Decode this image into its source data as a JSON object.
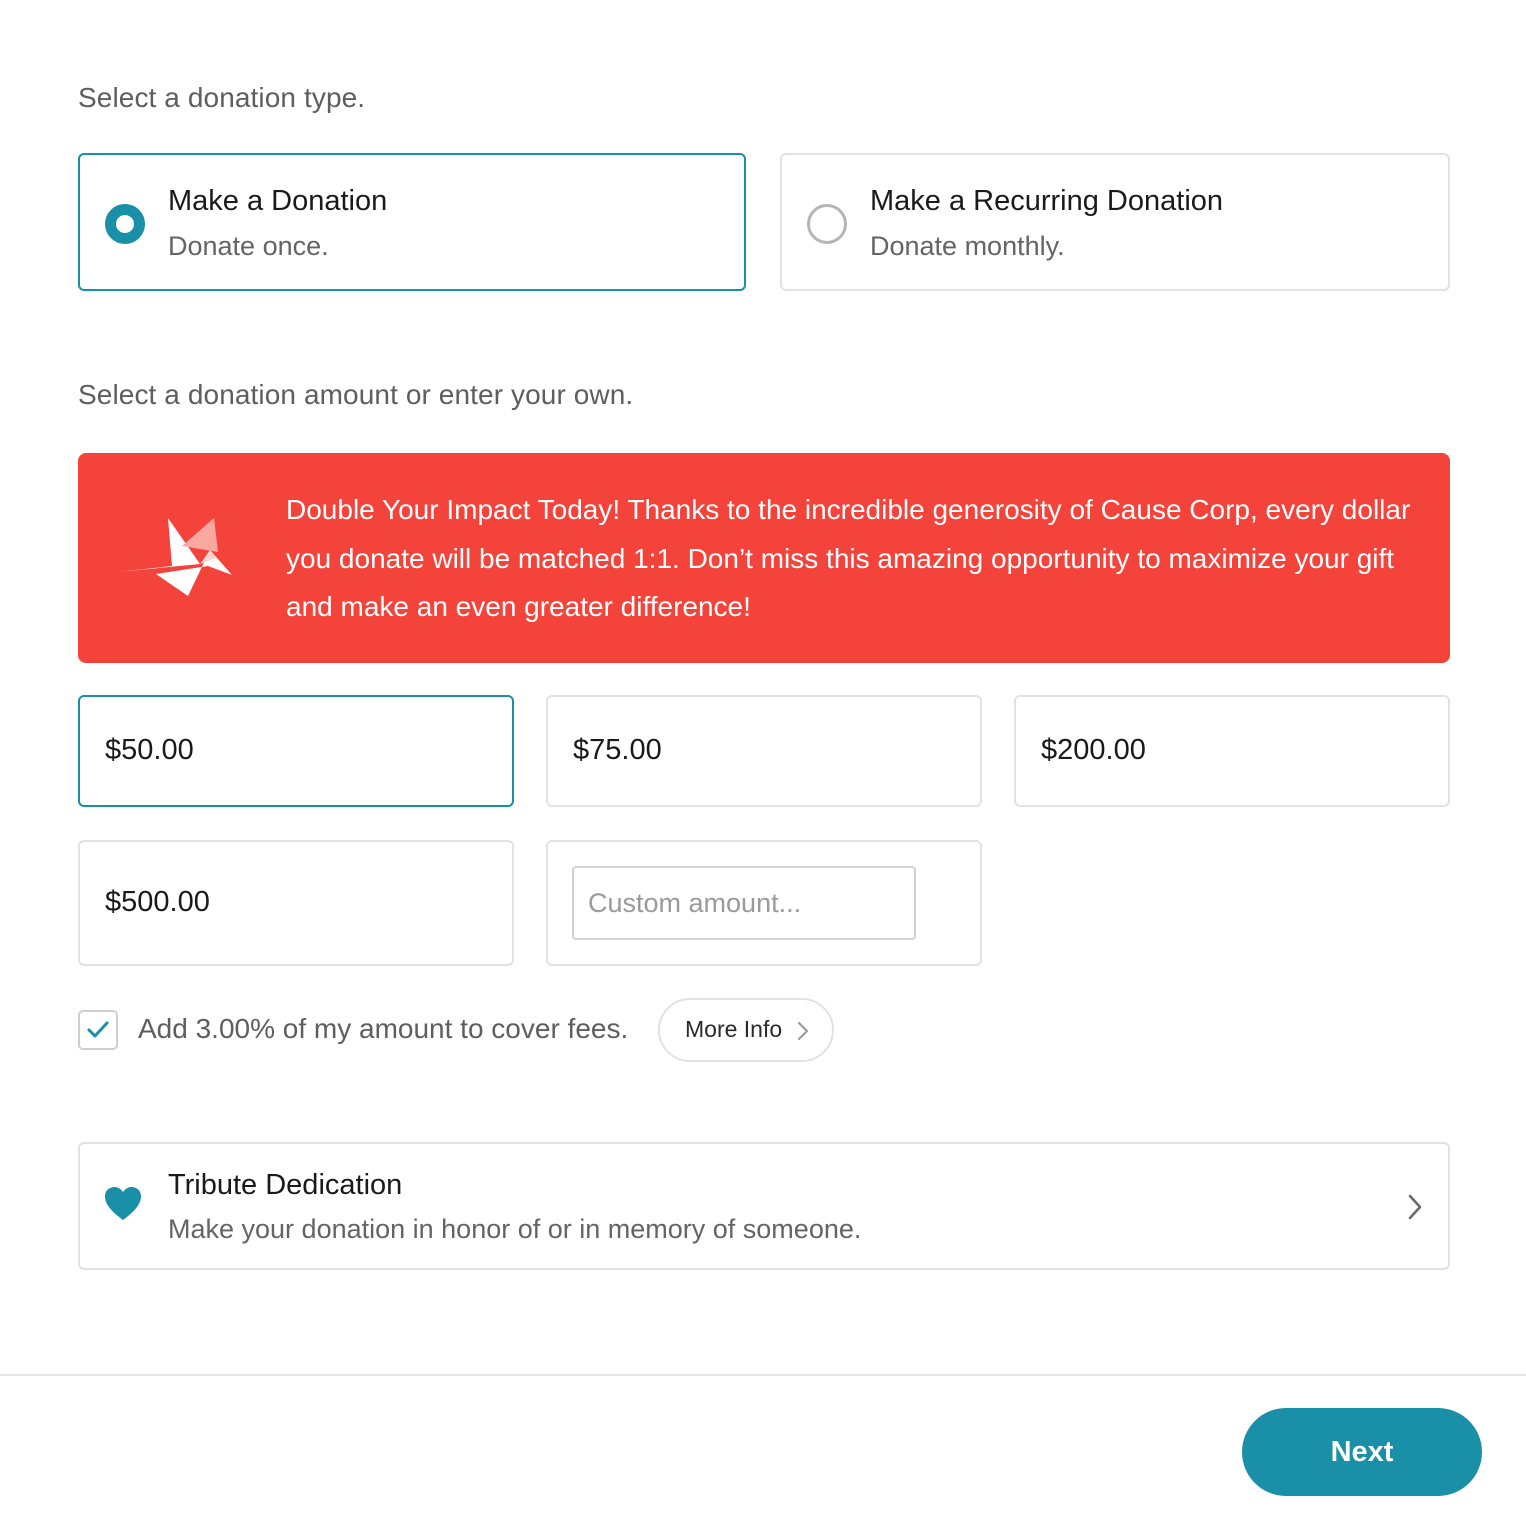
{
  "donation_type": {
    "prompt": "Select a donation type.",
    "options": [
      {
        "title": "Make a Donation",
        "subtitle": "Donate once.",
        "selected": true
      },
      {
        "title": "Make a Recurring Donation",
        "subtitle": "Donate monthly.",
        "selected": false
      }
    ]
  },
  "amount": {
    "prompt": "Select a donation amount or enter your own.",
    "presets": [
      {
        "label": "$50.00",
        "selected": true
      },
      {
        "label": "$75.00",
        "selected": false
      },
      {
        "label": "$200.00",
        "selected": false
      },
      {
        "label": "$500.00",
        "selected": false
      }
    ],
    "custom": {
      "value": "",
      "placeholder": "Custom amount..."
    }
  },
  "banner": {
    "icon": "origami-bird-icon",
    "text": "Double Your Impact Today! Thanks to the incredible generosity of Cause Corp, every dollar you donate will be matched 1:1. Don’t miss this amazing opportunity to maximize your gift and make an even greater difference!",
    "color": "#f4433a"
  },
  "fees": {
    "checked": true,
    "label": "Add 3.00% of my amount to cover fees.",
    "more_info_label": "More Info"
  },
  "tribute": {
    "icon": "heart-icon",
    "title": "Tribute Dedication",
    "subtitle": "Make your donation in honor of or in memory of someone."
  },
  "footer": {
    "next_label": "Next"
  },
  "colors": {
    "accent": "#1a8fa8",
    "border": "#e2e2e2",
    "banner": "#f4433a"
  }
}
